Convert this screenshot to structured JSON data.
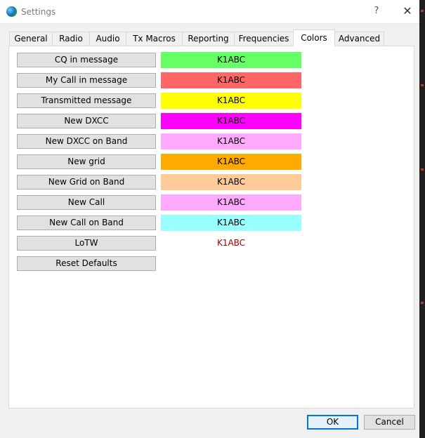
{
  "window": {
    "title": "Settings",
    "help_label": "?",
    "close_label": "✕"
  },
  "tabs": [
    {
      "label": "General"
    },
    {
      "label": "Radio"
    },
    {
      "label": "Audio"
    },
    {
      "label": "Tx Macros"
    },
    {
      "label": "Reporting"
    },
    {
      "label": "Frequencies"
    },
    {
      "label": "Colors",
      "active": true
    },
    {
      "label": "Advanced"
    }
  ],
  "colors": {
    "rows": [
      {
        "button": "CQ in message",
        "sample": "K1ABC",
        "bg": "#66ff66",
        "fg": "#000000"
      },
      {
        "button": "My Call in message",
        "sample": "K1ABC",
        "bg": "#ff6666",
        "fg": "#000000"
      },
      {
        "button": "Transmitted message",
        "sample": "K1ABC",
        "bg": "#ffff00",
        "fg": "#000000"
      },
      {
        "button": "New DXCC",
        "sample": "K1ABC",
        "bg": "#ff00ff",
        "fg": "#000000"
      },
      {
        "button": "New DXCC on Band",
        "sample": "K1ABC",
        "bg": "#ffaaff",
        "fg": "#000000"
      },
      {
        "button": "New grid",
        "sample": "K1ABC",
        "bg": "#ffaa00",
        "fg": "#000000"
      },
      {
        "button": "New Grid on Band",
        "sample": "K1ABC",
        "bg": "#ffcc99",
        "fg": "#000000"
      },
      {
        "button": "New Call",
        "sample": "K1ABC",
        "bg": "#ffaaff",
        "fg": "#000000"
      },
      {
        "button": "New Call on Band",
        "sample": "K1ABC",
        "bg": "#99ffff",
        "fg": "#000000"
      },
      {
        "button": "LoTW",
        "sample": "K1ABC",
        "bg": "#ffffff",
        "fg": "#990000"
      }
    ],
    "reset_label": "Reset Defaults"
  },
  "footer": {
    "ok_label": "OK",
    "cancel_label": "Cancel"
  }
}
